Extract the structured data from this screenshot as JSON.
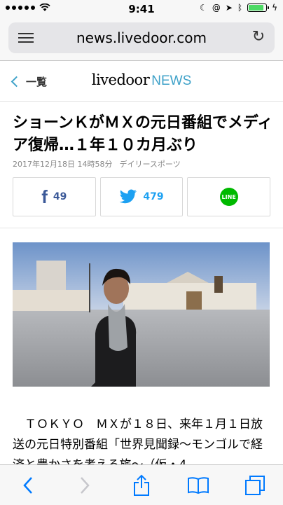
{
  "status_bar": {
    "time": "9:41"
  },
  "browser": {
    "url": "news.livedoor.com"
  },
  "site_header": {
    "back_label": "一覧",
    "logo_main": "livedoor",
    "logo_sub": "NEWS"
  },
  "article": {
    "headline": "ショーンＫがＭＸの元日番組でメディア復帰…１年１０カ月ぶり",
    "date": "2017年12月18日 14時58分",
    "source": "デイリースポーツ",
    "body": "　ＴＯＫＹＯ　ＭＸが１８日、来年１月１日放送の元日特別番組「世界見聞録〜モンゴルで経済と豊かさを考える旅〜（仮・4",
    "photo_icon": "photo-icon"
  },
  "share": {
    "facebook_count": "49",
    "twitter_count": "479",
    "line_label": "LINE"
  },
  "colors": {
    "accent": "#3fa2c9",
    "facebook": "#3b5998",
    "twitter": "#1da1f2",
    "line": "#00b900",
    "ios_blue": "#007aff"
  }
}
